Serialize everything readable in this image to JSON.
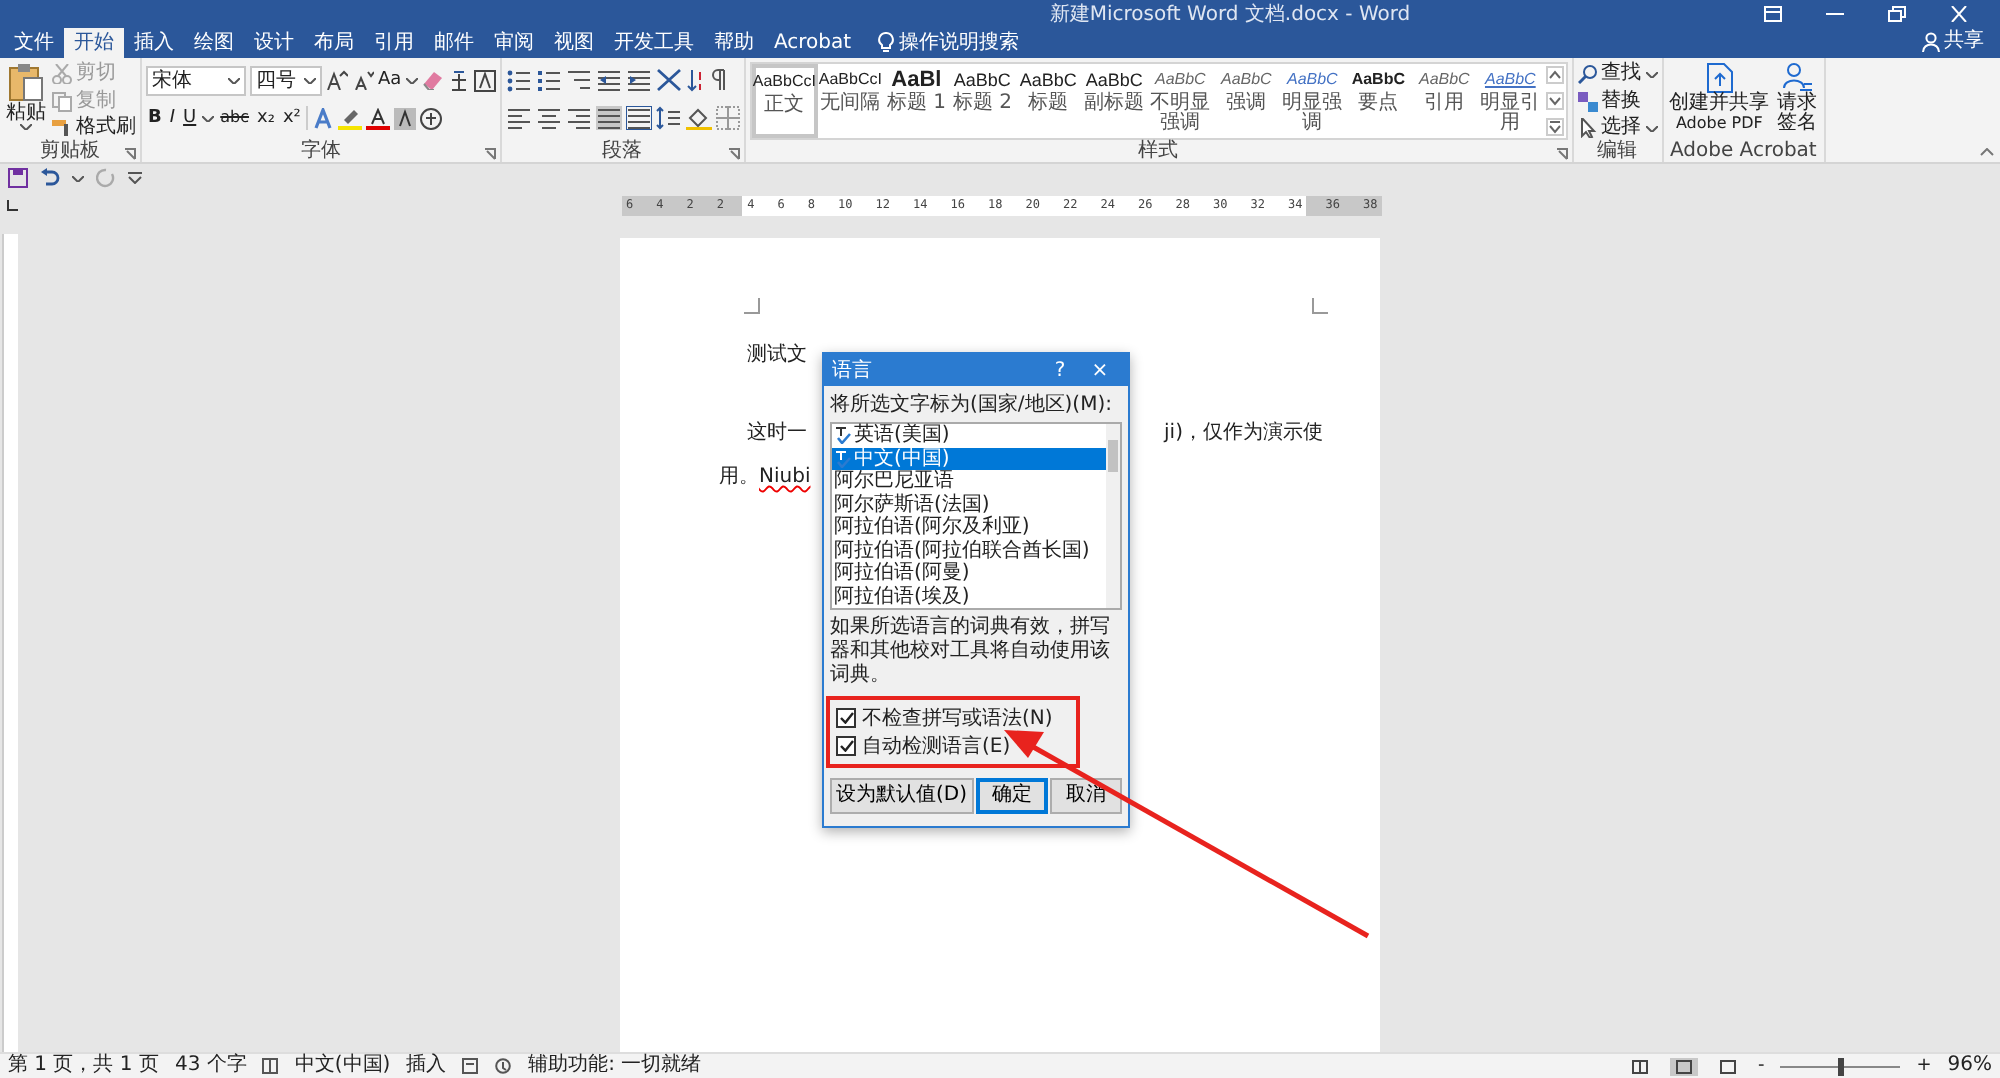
{
  "window": {
    "title": "新建Microsoft Word 文档.docx - Word",
    "share": "共享"
  },
  "tabs": [
    {
      "label": "文件",
      "selected": false
    },
    {
      "label": "开始",
      "selected": true
    },
    {
      "label": "插入",
      "selected": false
    },
    {
      "label": "绘图",
      "selected": false
    },
    {
      "label": "设计",
      "selected": false
    },
    {
      "label": "布局",
      "selected": false
    },
    {
      "label": "引用",
      "selected": false
    },
    {
      "label": "邮件",
      "selected": false
    },
    {
      "label": "审阅",
      "selected": false
    },
    {
      "label": "视图",
      "selected": false
    },
    {
      "label": "开发工具",
      "selected": false
    },
    {
      "label": "帮助",
      "selected": false
    },
    {
      "label": "Acrobat",
      "selected": false
    }
  ],
  "tell_me": "操作说明搜索",
  "ribbon": {
    "clipboard": {
      "paste": "粘贴",
      "cut": "剪切",
      "copy": "复制",
      "format_painter": "格式刷",
      "label": "剪贴板"
    },
    "font": {
      "name": "宋体",
      "size": "四号",
      "case": "Aa",
      "buttons": [
        "B",
        "I",
        "U",
        "abc",
        "x₂",
        "x²"
      ],
      "label": "字体"
    },
    "paragraph": {
      "label": "段落"
    },
    "styles": {
      "label": "样式",
      "items": [
        {
          "preview": "AaBbCcI",
          "name": "正文",
          "kind": "normal",
          "selected": true
        },
        {
          "preview": "AaBbCcI",
          "name": "无间隔",
          "kind": "normal",
          "selected": false
        },
        {
          "preview": "AaBl",
          "name": "标题 1",
          "kind": "heading",
          "selected": false
        },
        {
          "preview": "AaBbC",
          "name": "标题 2",
          "kind": "heading2",
          "selected": false
        },
        {
          "preview": "AaBbC",
          "name": "标题",
          "kind": "heading2",
          "selected": false
        },
        {
          "preview": "AaBbC",
          "name": "副标题",
          "kind": "heading2",
          "selected": false
        },
        {
          "preview": "AaBbC",
          "name": "不明显强调",
          "kind": "subtle",
          "selected": false
        },
        {
          "preview": "AaBbC",
          "name": "强调",
          "kind": "subtle",
          "selected": false
        },
        {
          "preview": "AaBbC",
          "name": "明显强调",
          "kind": "intense",
          "selected": false
        },
        {
          "preview": "AaBbC",
          "name": "要点",
          "kind": "strong",
          "selected": false
        },
        {
          "preview": "AaBbC",
          "name": "引用",
          "kind": "subtle",
          "selected": false
        },
        {
          "preview": "AaBbC",
          "name": "明显引用",
          "kind": "intense-quote",
          "selected": false
        }
      ]
    },
    "editing": {
      "find": "查找",
      "replace": "替换",
      "select": "选择",
      "label": "编辑"
    },
    "acrobat": {
      "create": "创建并共享",
      "create_sub": "Adobe PDF",
      "sign": "请求",
      "sign_sub": "签名",
      "label": "Adobe Acrobat"
    }
  },
  "ruler": {
    "numbers": [
      "6",
      "4",
      "2",
      "2",
      "4",
      "6",
      "8",
      "10",
      "12",
      "14",
      "16",
      "18",
      "20",
      "22",
      "24",
      "26",
      "28",
      "30",
      "32",
      "34",
      "36",
      "38"
    ]
  },
  "document": {
    "heading": "测试文",
    "line1_left": "这时一",
    "line1_right": "ji)，仅作为演示使",
    "line2": [
      {
        "text": "用。",
        "misspelled": false
      },
      {
        "text": "Niubi",
        "misspelled": true
      }
    ]
  },
  "dialog": {
    "title": "语言",
    "help": "?",
    "close": "×",
    "label": "将所选文字标为(国家/地区)(M):",
    "languages": [
      {
        "name": "英语(美国)",
        "proofing": true,
        "selected": false
      },
      {
        "name": "中文(中国)",
        "proofing": true,
        "selected": true
      },
      {
        "name": "阿尔巴尼亚语",
        "proofing": false,
        "selected": false
      },
      {
        "name": "阿尔萨斯语(法国)",
        "proofing": false,
        "selected": false
      },
      {
        "name": "阿拉伯语(阿尔及利亚)",
        "proofing": false,
        "selected": false
      },
      {
        "name": "阿拉伯语(阿拉伯联合酋长国)",
        "proofing": false,
        "selected": false
      },
      {
        "name": "阿拉伯语(阿曼)",
        "proofing": false,
        "selected": false
      },
      {
        "name": "阿拉伯语(埃及)",
        "proofing": false,
        "selected": false
      }
    ],
    "note": "如果所选语言的词典有效，拼写器和其他校对工具将自动使用该词典。",
    "options": [
      {
        "label": "不检查拼写或语法(N)",
        "checked": true
      },
      {
        "label": "自动检测语言(E)",
        "checked": true
      }
    ],
    "buttons": [
      {
        "label": "设为默认值(D)",
        "default": false
      },
      {
        "label": "确定",
        "default": true
      },
      {
        "label": "取消",
        "default": false
      }
    ]
  },
  "status_bar": {
    "page": "第 1 页，共 1 页",
    "words": "43 个字",
    "language": "中文(中国)",
    "mode": "插入",
    "accessibility": "辅助功能: 一切就绪",
    "views": [
      {
        "selected": false
      },
      {
        "selected": true
      },
      {
        "selected": false
      }
    ],
    "zoom_out": "-",
    "zoom_in": "+",
    "zoom": {
      "level": 0.5
    },
    "zoom_text": "96%"
  }
}
